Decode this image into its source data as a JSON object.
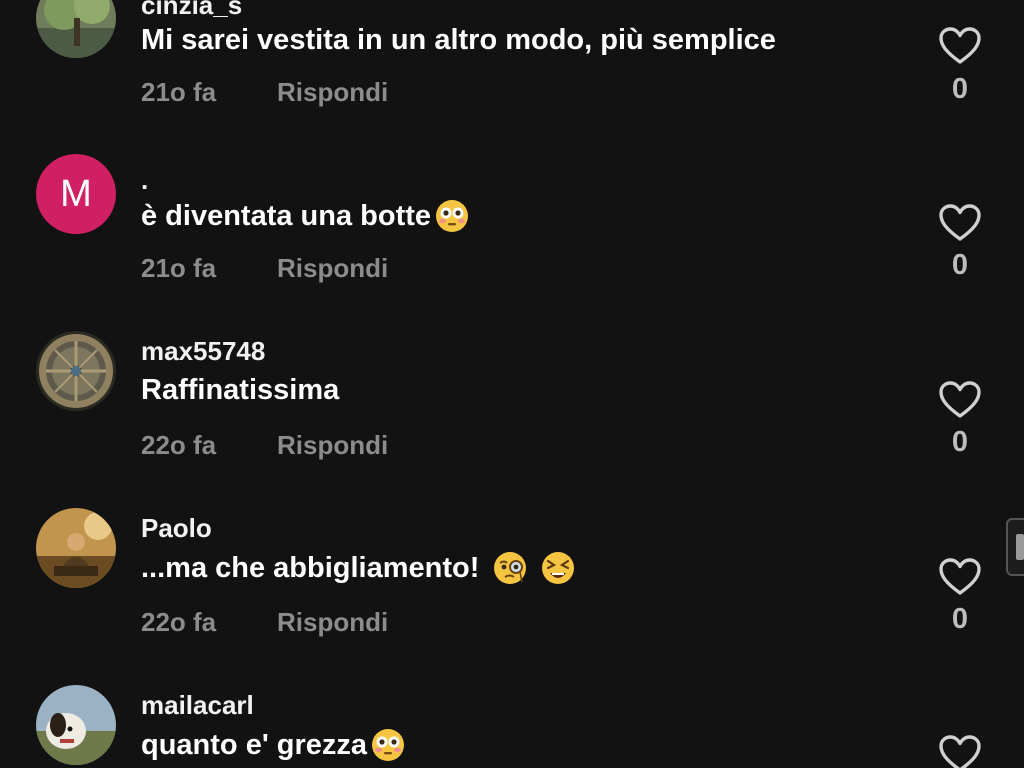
{
  "comments": [
    {
      "username": "cinzia_s",
      "text": "Mi sarei vestita in un altro modo, più semplice",
      "time": "21o fa",
      "reply": "Rispondi",
      "likes": "0",
      "avatar": "tree-photo"
    },
    {
      "username": ".",
      "text": "è diventata una botte",
      "time": "21o fa",
      "reply": "Rispondi",
      "likes": "0",
      "avatar_letter": "M",
      "avatar_color": "#d11f63",
      "emojis": [
        "flushed-face-emoji"
      ]
    },
    {
      "username": "max55748",
      "text": "Raffinatissima",
      "time": "22o fa",
      "reply": "Rispondi",
      "likes": "0",
      "avatar": "wheel-photo"
    },
    {
      "username": "Paolo",
      "text": "...ma che abbigliamento!",
      "time": "22o fa",
      "reply": "Rispondi",
      "likes": "0",
      "avatar": "painting-photo",
      "emojis": [
        "monocle-face-emoji",
        "tired-face-emoji"
      ]
    },
    {
      "username": "mailacarl",
      "text": "quanto e' grezza",
      "avatar": "dog-photo",
      "emojis": [
        "flushed-face-emoji"
      ]
    }
  ],
  "icons": {
    "like": "heart-outline-icon",
    "scroll": "scroll-handle"
  },
  "colors": {
    "background": "#121212",
    "meta_text": "#8c8c8c",
    "avatar_m": "#d11f63"
  }
}
